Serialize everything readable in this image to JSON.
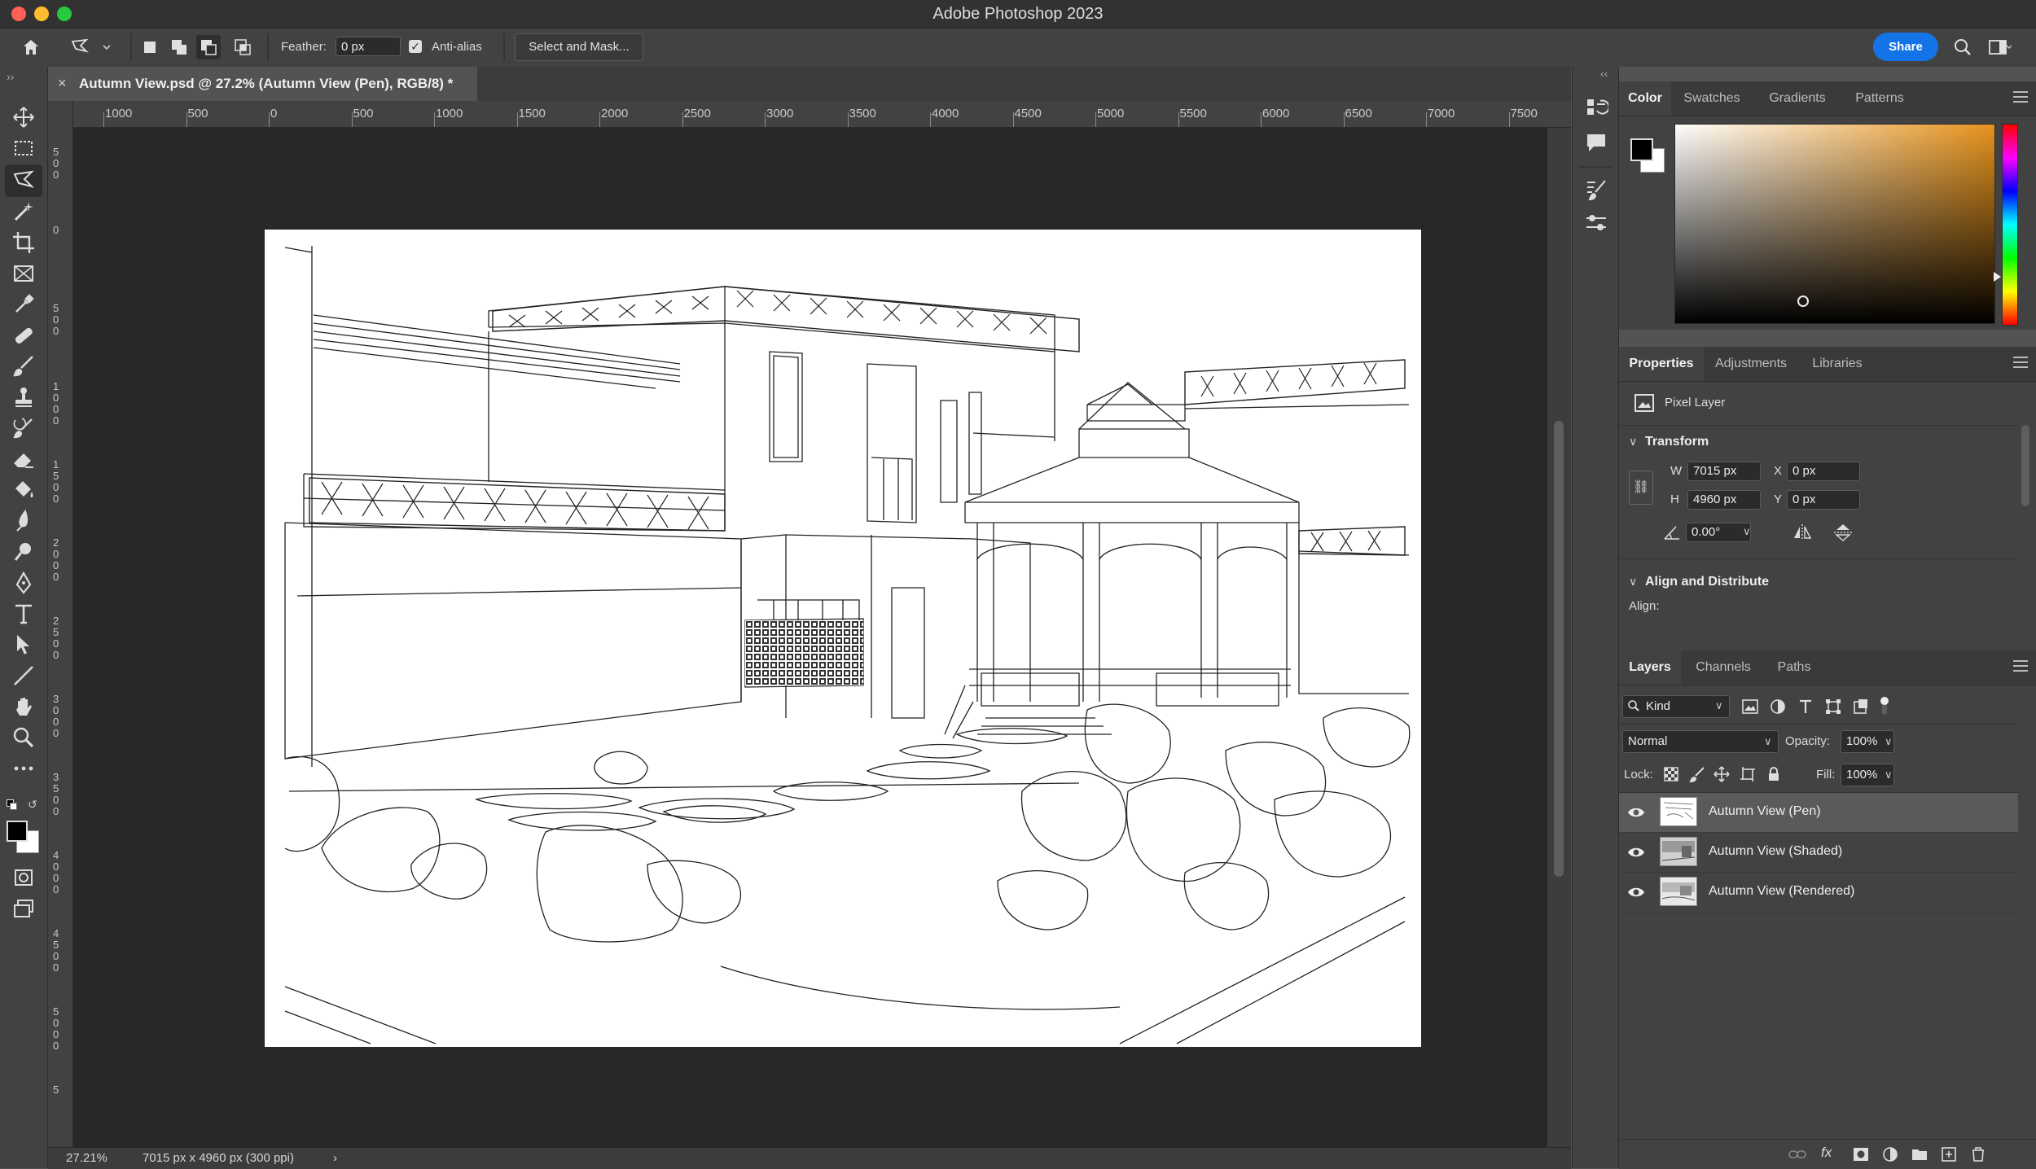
{
  "app": {
    "title": "Adobe Photoshop 2023",
    "colors": {
      "close": "#fe5f57",
      "minimize": "#febc2e",
      "maximize": "#28c840",
      "accent": "#1473e6"
    }
  },
  "options_bar": {
    "feather_label": "Feather:",
    "feather_value": "0 px",
    "anti_alias_label": "Anti-alias",
    "anti_alias_checked": true,
    "select_mask_label": "Select and Mask...",
    "share_label": "Share"
  },
  "document": {
    "tab_title": "Autumn View.psd @ 27.2% (Autumn View (Pen), RGB/8) *",
    "close_symbol": "×"
  },
  "ruler": {
    "horizontal": [
      "1000",
      "500",
      "0",
      "500",
      "1000",
      "1500",
      "2000",
      "2500",
      "3000",
      "3500",
      "4000",
      "4500",
      "5000",
      "5500",
      "6000",
      "6500",
      "7000",
      "7500"
    ],
    "vertical": [
      "500",
      "0",
      "500",
      "1000",
      "1500",
      "2000",
      "2500",
      "3000",
      "3500",
      "4000",
      "4500",
      "5000",
      "5"
    ]
  },
  "status": {
    "zoom": "27.21%",
    "doc_size": "7015 px x 4960 px (300 ppi)",
    "arrow": "›"
  },
  "color_panel": {
    "tabs": [
      "Color",
      "Swatches",
      "Gradients",
      "Patterns"
    ],
    "active_tab": "Color",
    "foreground": "#000000",
    "background": "#ffffff",
    "hue_color": "#e6931c"
  },
  "properties_panel": {
    "tabs": [
      "Properties",
      "Adjustments",
      "Libraries"
    ],
    "active_tab": "Properties",
    "layer_type": "Pixel Layer",
    "transform_title": "Transform",
    "w_label": "W",
    "w_value": "7015 px",
    "h_label": "H",
    "h_value": "4960 px",
    "x_label": "X",
    "x_value": "0 px",
    "y_label": "Y",
    "y_value": "0 px",
    "angle_value": "0.00°",
    "align_title": "Align and Distribute",
    "align_label": "Align:"
  },
  "layers_panel": {
    "tabs": [
      "Layers",
      "Channels",
      "Paths"
    ],
    "active_tab": "Layers",
    "kind_label": "Kind",
    "blend_mode": "Normal",
    "opacity_label": "Opacity:",
    "opacity_value": "100%",
    "lock_label": "Lock:",
    "fill_label": "Fill:",
    "fill_value": "100%",
    "layers": [
      {
        "name": "Autumn View (Pen)",
        "visible": true,
        "selected": true
      },
      {
        "name": "Autumn View (Shaded)",
        "visible": true,
        "selected": false
      },
      {
        "name": "Autumn View (Rendered)",
        "visible": true,
        "selected": false
      }
    ]
  }
}
